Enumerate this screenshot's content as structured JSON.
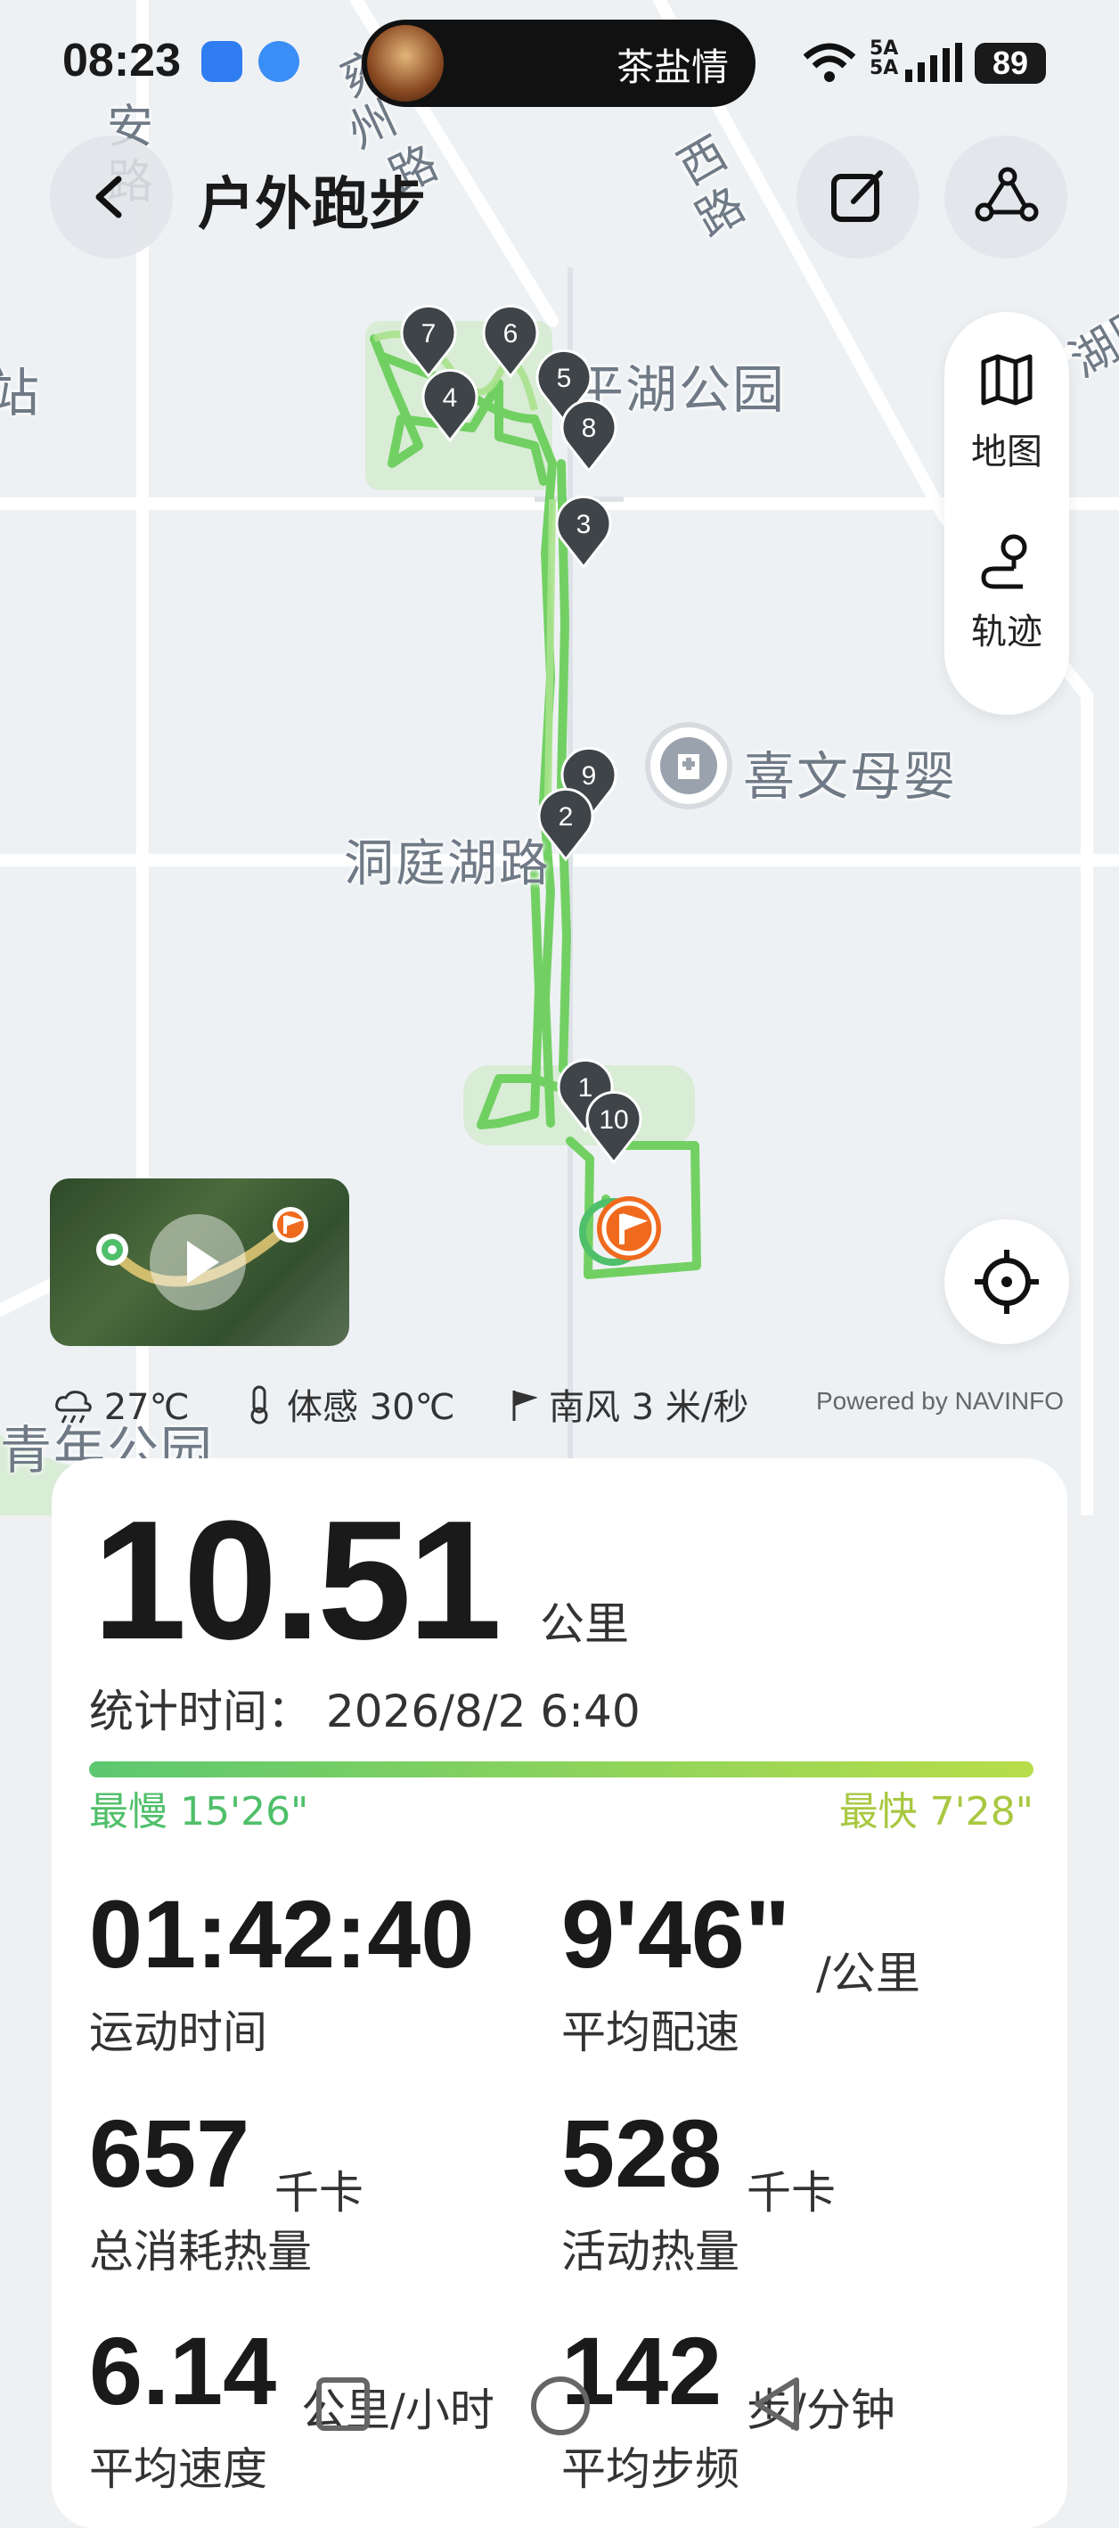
{
  "status_bar": {
    "time": "08:23",
    "island_name": "茶盐情",
    "signal_label": "5A",
    "battery": "89"
  },
  "header": {
    "title": "户外跑步"
  },
  "map": {
    "labels": [
      "安",
      "路",
      "雍",
      "州",
      "路",
      "西",
      "路",
      "站",
      "平湖公园",
      "喜文母婴",
      "洞庭湖路",
      "青年公园",
      "湖阳"
    ],
    "markers": [
      "7",
      "6",
      "5",
      "4",
      "8",
      "3",
      "9",
      "2",
      "1",
      "10"
    ],
    "side_panel": {
      "map_label": "地图",
      "track_label": "轨迹"
    },
    "attribution": "Powered by NAVINFO"
  },
  "weather": {
    "temp": "27℃",
    "feels_like": "体感 30℃",
    "wind": "南风  3 米/秒"
  },
  "summary": {
    "distance": "10.51",
    "distance_unit": "公里",
    "stat_time": "统计时间：  2026/8/2 6:40",
    "slowest": "最慢 15'26\"",
    "fastest": "最快 7'28\"",
    "metrics": [
      {
        "value": "01:42:40",
        "unit": "",
        "label": "运动时间"
      },
      {
        "value": "9'46\"",
        "unit": "/公里",
        "label": "平均配速"
      },
      {
        "value": "657",
        "unit": "千卡",
        "label": "总消耗热量"
      },
      {
        "value": "528",
        "unit": "千卡",
        "label": "活动热量"
      },
      {
        "value": "6.14",
        "unit": "公里/小时",
        "label": "平均速度"
      },
      {
        "value": "142",
        "unit": "步/分钟",
        "label": "平均步频"
      }
    ]
  },
  "colors": {
    "track": "#6ccf5c",
    "accent_green": "#4fbf6a",
    "flag": "#f06a1e",
    "marker": "#3f4449"
  }
}
